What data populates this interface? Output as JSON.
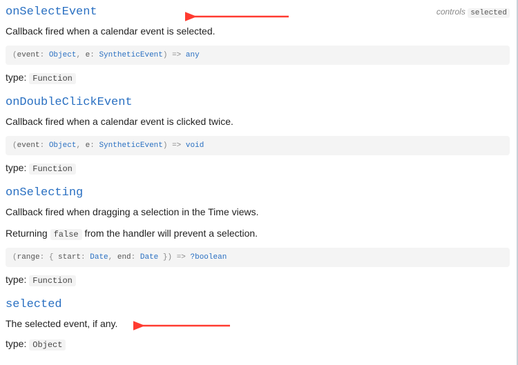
{
  "controls_label": "controls",
  "type_label": "type:",
  "entries": [
    {
      "name": "onSelectEvent",
      "controls": "selected",
      "desc_plain": "Callback fired when a calendar event is selected.",
      "sig": {
        "p1_name": "event",
        "p1_type": "Object",
        "p2_name": "e",
        "p2_type": "SyntheticEvent",
        "ret": "any"
      },
      "type": "Function"
    },
    {
      "name": "onDoubleClickEvent",
      "desc_plain": "Callback fired when a calendar event is clicked twice.",
      "sig": {
        "p1_name": "event",
        "p1_type": "Object",
        "p2_name": "e",
        "p2_type": "SyntheticEvent",
        "ret": "void"
      },
      "type": "Function"
    },
    {
      "name": "onSelecting",
      "desc_plain": "Callback fired when dragging a selection in the Time views.",
      "desc2_pre": "Returning ",
      "desc2_code": "false",
      "desc2_post": " from the handler will prevent a selection.",
      "sig_range": {
        "p_name": "range",
        "f1_name": "start",
        "f1_type": "Date",
        "f2_name": "end",
        "f2_type": "Date",
        "ret": "?boolean"
      },
      "type": "Function"
    },
    {
      "name": "selected",
      "desc_plain": "The selected event, if any.",
      "type": "Object"
    }
  ],
  "annotations": {
    "arrow_to_onSelectEvent": true,
    "arrow_to_selected_desc": true
  }
}
